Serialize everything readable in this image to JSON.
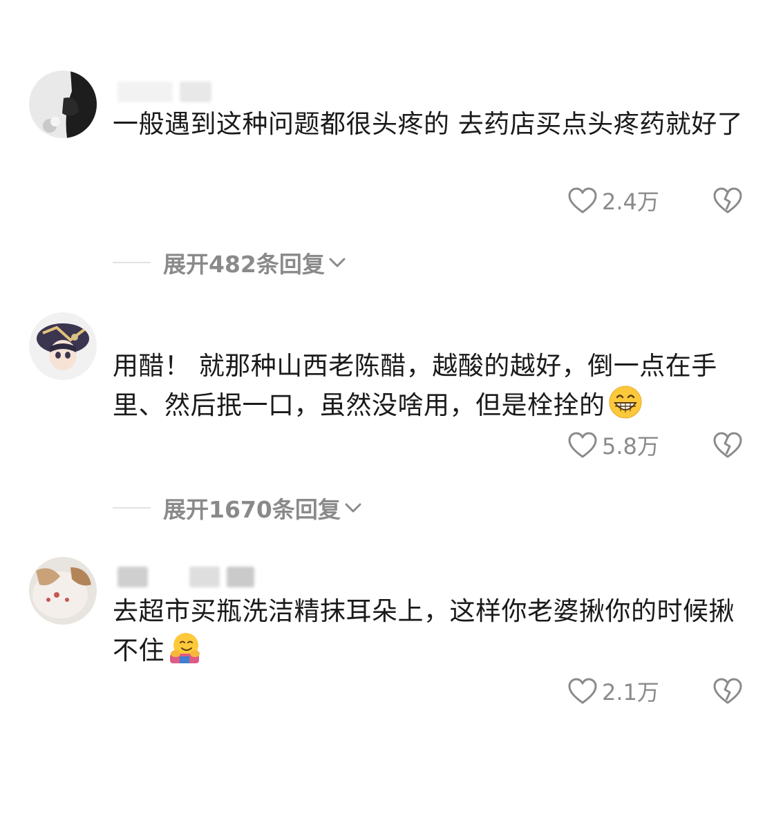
{
  "comments": [
    {
      "text": "一般遇到这种问题都很头疼的 去药店买点头疼药就好了",
      "likes": "2.4万",
      "expand": "展开482条回复",
      "emoji": ""
    },
    {
      "text": "用醋！ 就那种山西老陈醋，越酸的越好，倒一点在手里、然后抿一口，虽然没啥用，但是栓拴的",
      "likes": "5.8万",
      "expand": "展开1670条回复",
      "emoji": "grinning-face-emoji"
    },
    {
      "text": "去超市买瓶洗洁精抹耳朵上，这样你老婆揪你的时候揪不住",
      "likes": "2.1万",
      "expand": "",
      "emoji": "hugging-face-emoji"
    }
  ],
  "icons": {
    "like": "heart-outline-icon",
    "dislike": "broken-heart-icon",
    "expand": "chevron-down-icon"
  },
  "colors": {
    "text": "#1a1a1a",
    "muted": "#8a8a8a",
    "divider": "#e2e2e2"
  }
}
